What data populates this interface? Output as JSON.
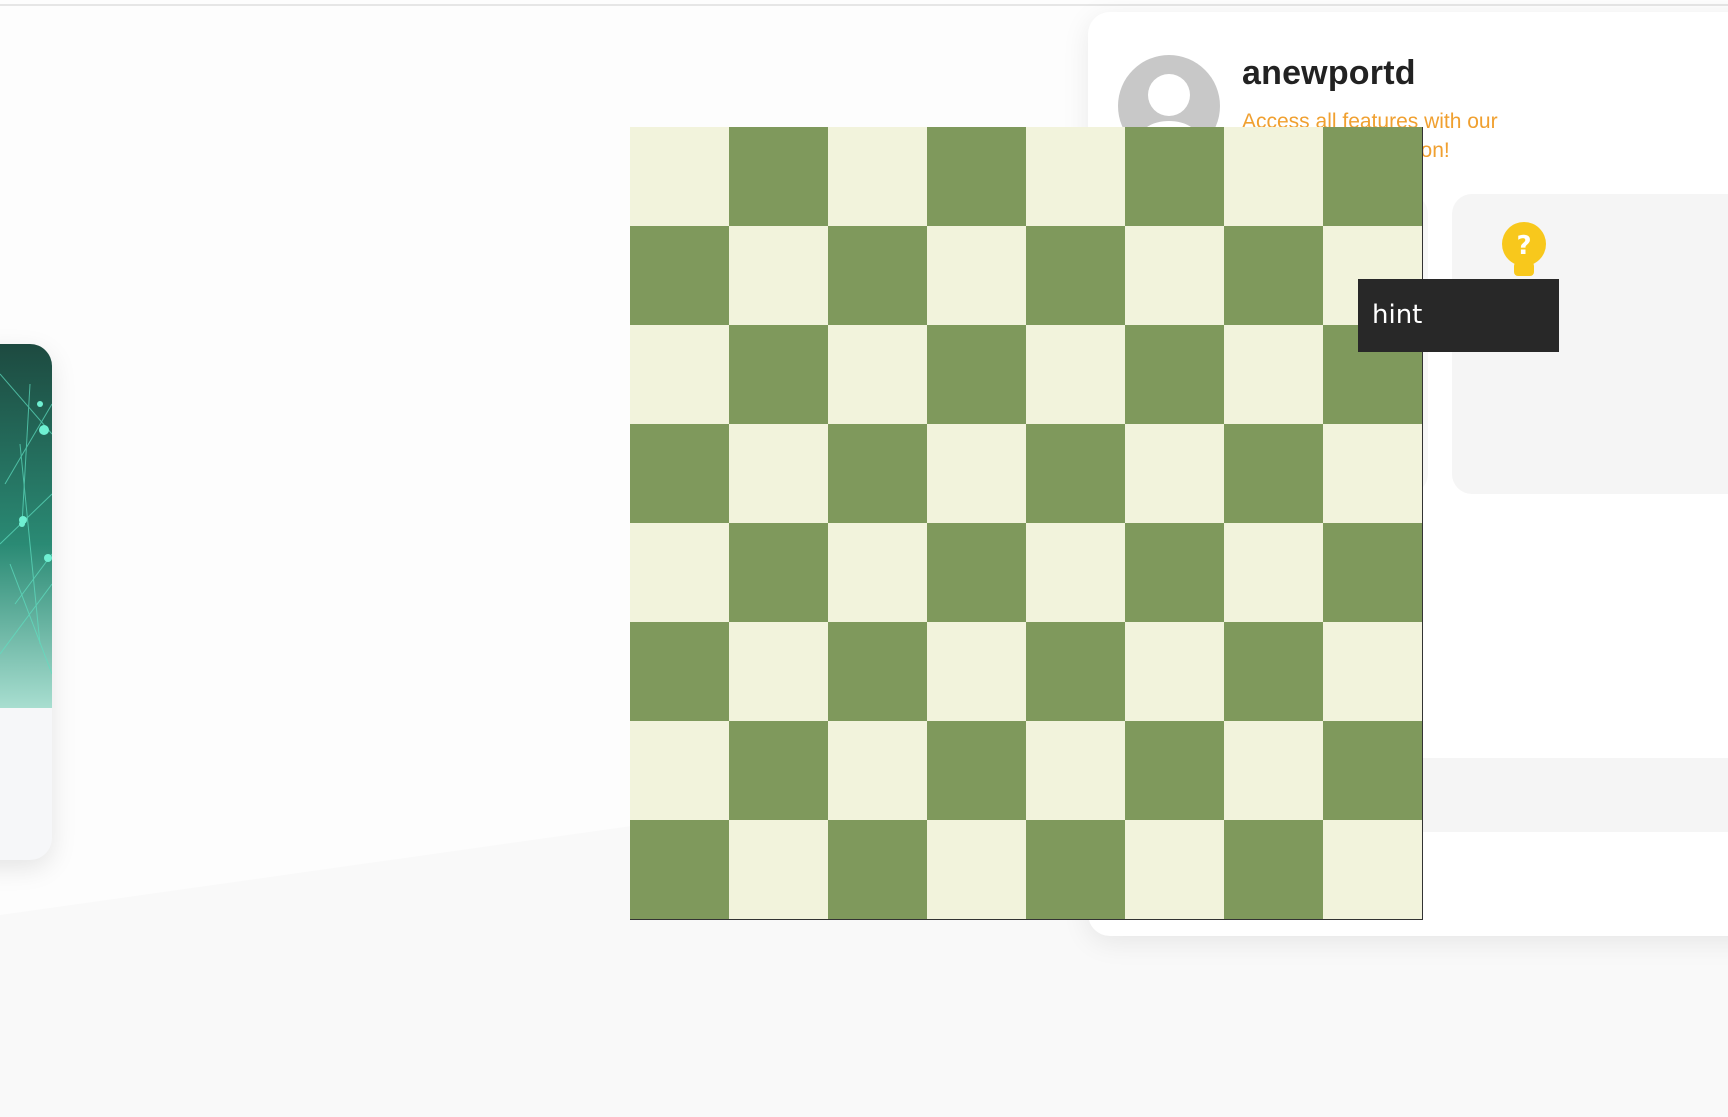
{
  "profile": {
    "username": "anewportd",
    "promo_text": "Access all features with our Premium subscription!"
  },
  "tooltip": {
    "text": "hint"
  },
  "hint_tile": {
    "icon": "lightbulb-question-icon",
    "label": ""
  },
  "board": {
    "rows": 8,
    "cols": 8,
    "light_color": "#f2f3dc",
    "dark_color": "#7f995c",
    "pieces": []
  },
  "colors": {
    "accent": "#f0a030",
    "tooltip_bg": "#282828"
  }
}
